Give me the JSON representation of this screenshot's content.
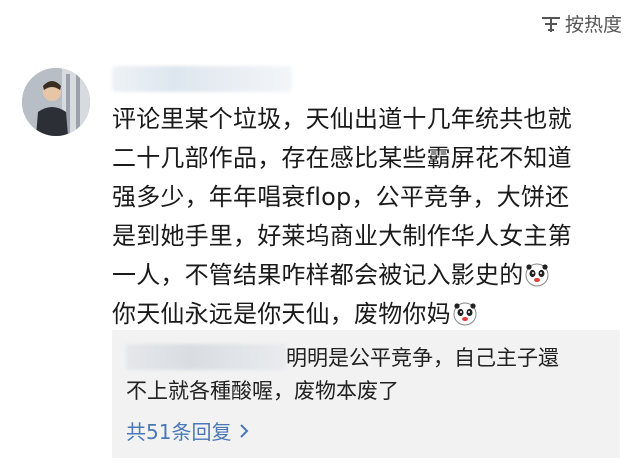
{
  "sort": {
    "label": "按热度",
    "icon": "sort-lines-icon"
  },
  "comment": {
    "avatar_icon": "user-avatar-photo",
    "lines": [
      "评论里某个垃圾，天仙出道十几年统共也就",
      "二十几部作品，存在感比某些霸屏花不知道",
      "强多少，年年唱衰flop，公平竞争，大饼还",
      "是到她手里，好莱坞商业大制作华人女主第",
      "一人，不管结果咋样都会被记入影史的",
      "你天仙永远是你天仙，废物你妈"
    ],
    "emoji_icon": "panda-face-emoji"
  },
  "reply": {
    "line1": "明明是公平竞争，自己主子還",
    "line2": "不上就各種酸喔，废物本废了",
    "count_label": "共51条回复",
    "chevron_icon": "chevron-right-icon"
  },
  "colors": {
    "text": "#1a1a1a",
    "link": "#4a78b8",
    "reply_bg": "#f2f2f2",
    "sort_text": "#555555"
  }
}
